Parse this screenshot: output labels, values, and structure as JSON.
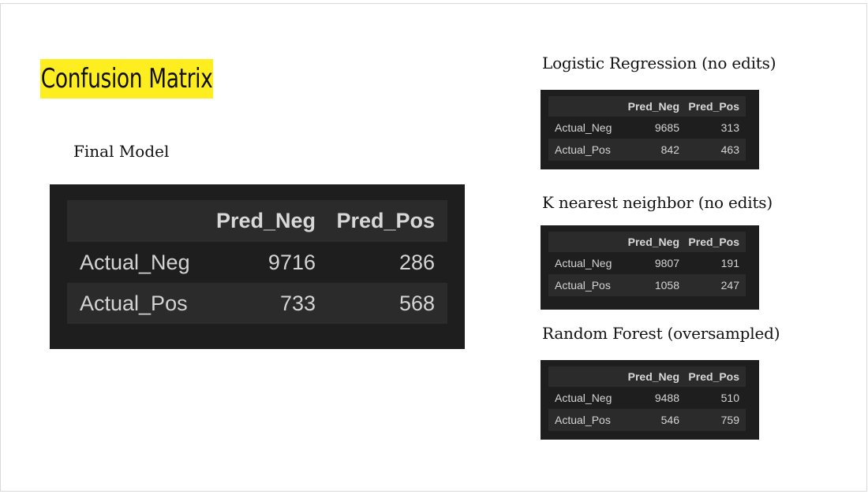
{
  "slide": {
    "title": "Confusion Matrix",
    "title_highlight_color": "#ffee1f"
  },
  "final_model": {
    "caption": "Final Model",
    "header": [
      "Pred_Neg",
      "Pred_Pos"
    ],
    "rows": [
      {
        "label": "Actual_Neg",
        "values": [
          "9716",
          "286"
        ]
      },
      {
        "label": "Actual_Pos",
        "values": [
          "733",
          "568"
        ]
      }
    ]
  },
  "logistic_regression": {
    "caption": "Logistic Regression (no edits)",
    "header": [
      "Pred_Neg",
      "Pred_Pos"
    ],
    "rows": [
      {
        "label": "Actual_Neg",
        "values": [
          "9685",
          "313"
        ]
      },
      {
        "label": "Actual_Pos",
        "values": [
          "842",
          "463"
        ]
      }
    ]
  },
  "knn": {
    "caption": "K nearest neighbor (no edits)",
    "header": [
      "Pred_Neg",
      "Pred_Pos"
    ],
    "rows": [
      {
        "label": "Actual_Neg",
        "values": [
          "9807",
          "191"
        ]
      },
      {
        "label": "Actual_Pos",
        "values": [
          "1058",
          "247"
        ]
      }
    ]
  },
  "random_forest": {
    "caption": "Random Forest (oversampled)",
    "header": [
      "Pred_Neg",
      "Pred_Pos"
    ],
    "rows": [
      {
        "label": "Actual_Neg",
        "values": [
          "9488",
          "510"
        ]
      },
      {
        "label": "Actual_Pos",
        "values": [
          "546",
          "759"
        ]
      }
    ]
  },
  "colors": {
    "table_background": "#1e1e1e",
    "table_row_stripe": "#2b2b2b",
    "table_text": "#d4d4d4"
  }
}
